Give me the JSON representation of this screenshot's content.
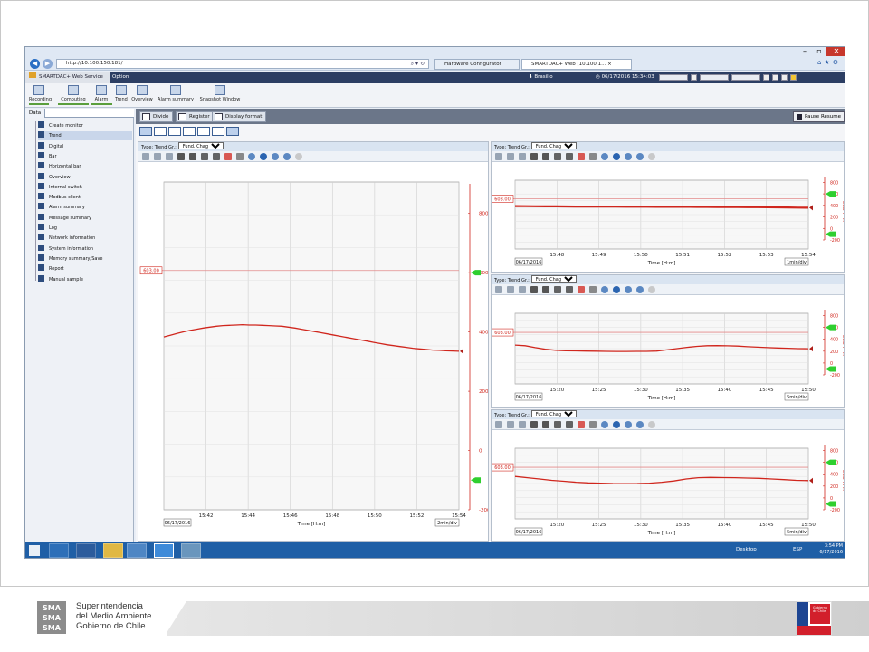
{
  "browser": {
    "url": "http://10.100.150.181/",
    "tabs": [
      "Hardware Configurator",
      "SMARTDAC+ Web [10.100.1..."
    ],
    "icons": [
      "home-icon",
      "star-icon",
      "gear-icon"
    ]
  },
  "app": {
    "tab_label": "SMARTDAC+ Web Service",
    "option_label": "Option",
    "user": "Brasilio",
    "datetime": "06/17/2016 15:34:03"
  },
  "toolbar": {
    "items": [
      "Recording",
      "Computing",
      "Alarm",
      "Trend",
      "Overview",
      "Alarm summary",
      "Snapshot Window"
    ]
  },
  "sidebar": {
    "header": "Data",
    "items": [
      "Create monitor",
      "Trend",
      "Digital",
      "Bar",
      "Horizontal bar",
      "Overview",
      "Internal switch",
      "Modbus client",
      "Alarm summary",
      "Message summary",
      "Log",
      "Network information",
      "System information",
      "Memory summary/Save",
      "Report",
      "Manual sample"
    ],
    "selected_index": 1
  },
  "content": {
    "buttons": [
      "Divide",
      "Register",
      "Display format"
    ],
    "pause_label": "Pause Resume"
  },
  "panels": [
    {
      "type_label": "Type: Trend",
      "gr_label": "Gr.:",
      "group": "Fund. Chagres",
      "limit": "603.00",
      "time_labels": [
        "15:42",
        "15:44",
        "15:46",
        "15:48",
        "15:50",
        "15:52",
        "15:54"
      ],
      "date": "06/17/2016",
      "axis_title": "Time [H:m]",
      "div": "2min/div",
      "scale_labels": [
        "800",
        "600",
        "400",
        "200",
        "0",
        "-200"
      ],
      "unit": "COD PPM"
    },
    {
      "type_label": "Type: Trend",
      "gr_label": "Gr.:",
      "group": "Fund. Chagres",
      "limit": "603.00",
      "time_labels": [
        "15:48",
        "15:49",
        "15:50",
        "15:51",
        "15:52",
        "15:53",
        "15:54"
      ],
      "date": "06/17/2016",
      "axis_title": "Time [H:m]",
      "div": "1min/div",
      "scale_labels": [
        "800",
        "600",
        "400",
        "200",
        "0",
        "-200"
      ],
      "unit": "COD PPM"
    },
    {
      "type_label": "Type: Trend",
      "gr_label": "Gr.:",
      "group": "Fund. Chagres",
      "limit": "603.00",
      "time_labels": [
        "15:20",
        "15:25",
        "15:30",
        "15:35",
        "15:40",
        "15:45",
        "15:50"
      ],
      "date": "06/17/2016",
      "axis_title": "Time [H:m]",
      "div": "5min/div",
      "scale_labels": [
        "800",
        "600",
        "400",
        "200",
        "0",
        "-200"
      ],
      "unit": "COD PPM"
    },
    {
      "type_label": "Type: Trend",
      "gr_label": "Gr.:",
      "group": "Fund. Chagres",
      "limit": "603.00",
      "time_labels": [
        "15:20",
        "15:25",
        "15:30",
        "15:35",
        "15:40",
        "15:45",
        "15:50"
      ],
      "date": "06/17/2016",
      "axis_title": "Time [H:m]",
      "div": "5min/div",
      "scale_labels": [
        "800",
        "600",
        "400",
        "200",
        "0",
        "-200"
      ],
      "unit": "COD PPM"
    }
  ],
  "taskbar": {
    "desktop_label": "Desktop",
    "lang": "ESP",
    "time": "3:54 PM",
    "date": "6/17/2016"
  },
  "footer": {
    "logo": "SMA",
    "org_line1": "Superintendencia",
    "org_line2": "del Medio Ambiente",
    "org_line3": "Gobierno de Chile",
    "flag_text": "Gobierno de Chile"
  },
  "colors": {
    "trend_line": "#d0261d",
    "limit_line": "#e38a8a",
    "scale_red": "#d0261d",
    "alarm_green": "#2fcf2f",
    "taskbar": "#1f5fa6"
  }
}
